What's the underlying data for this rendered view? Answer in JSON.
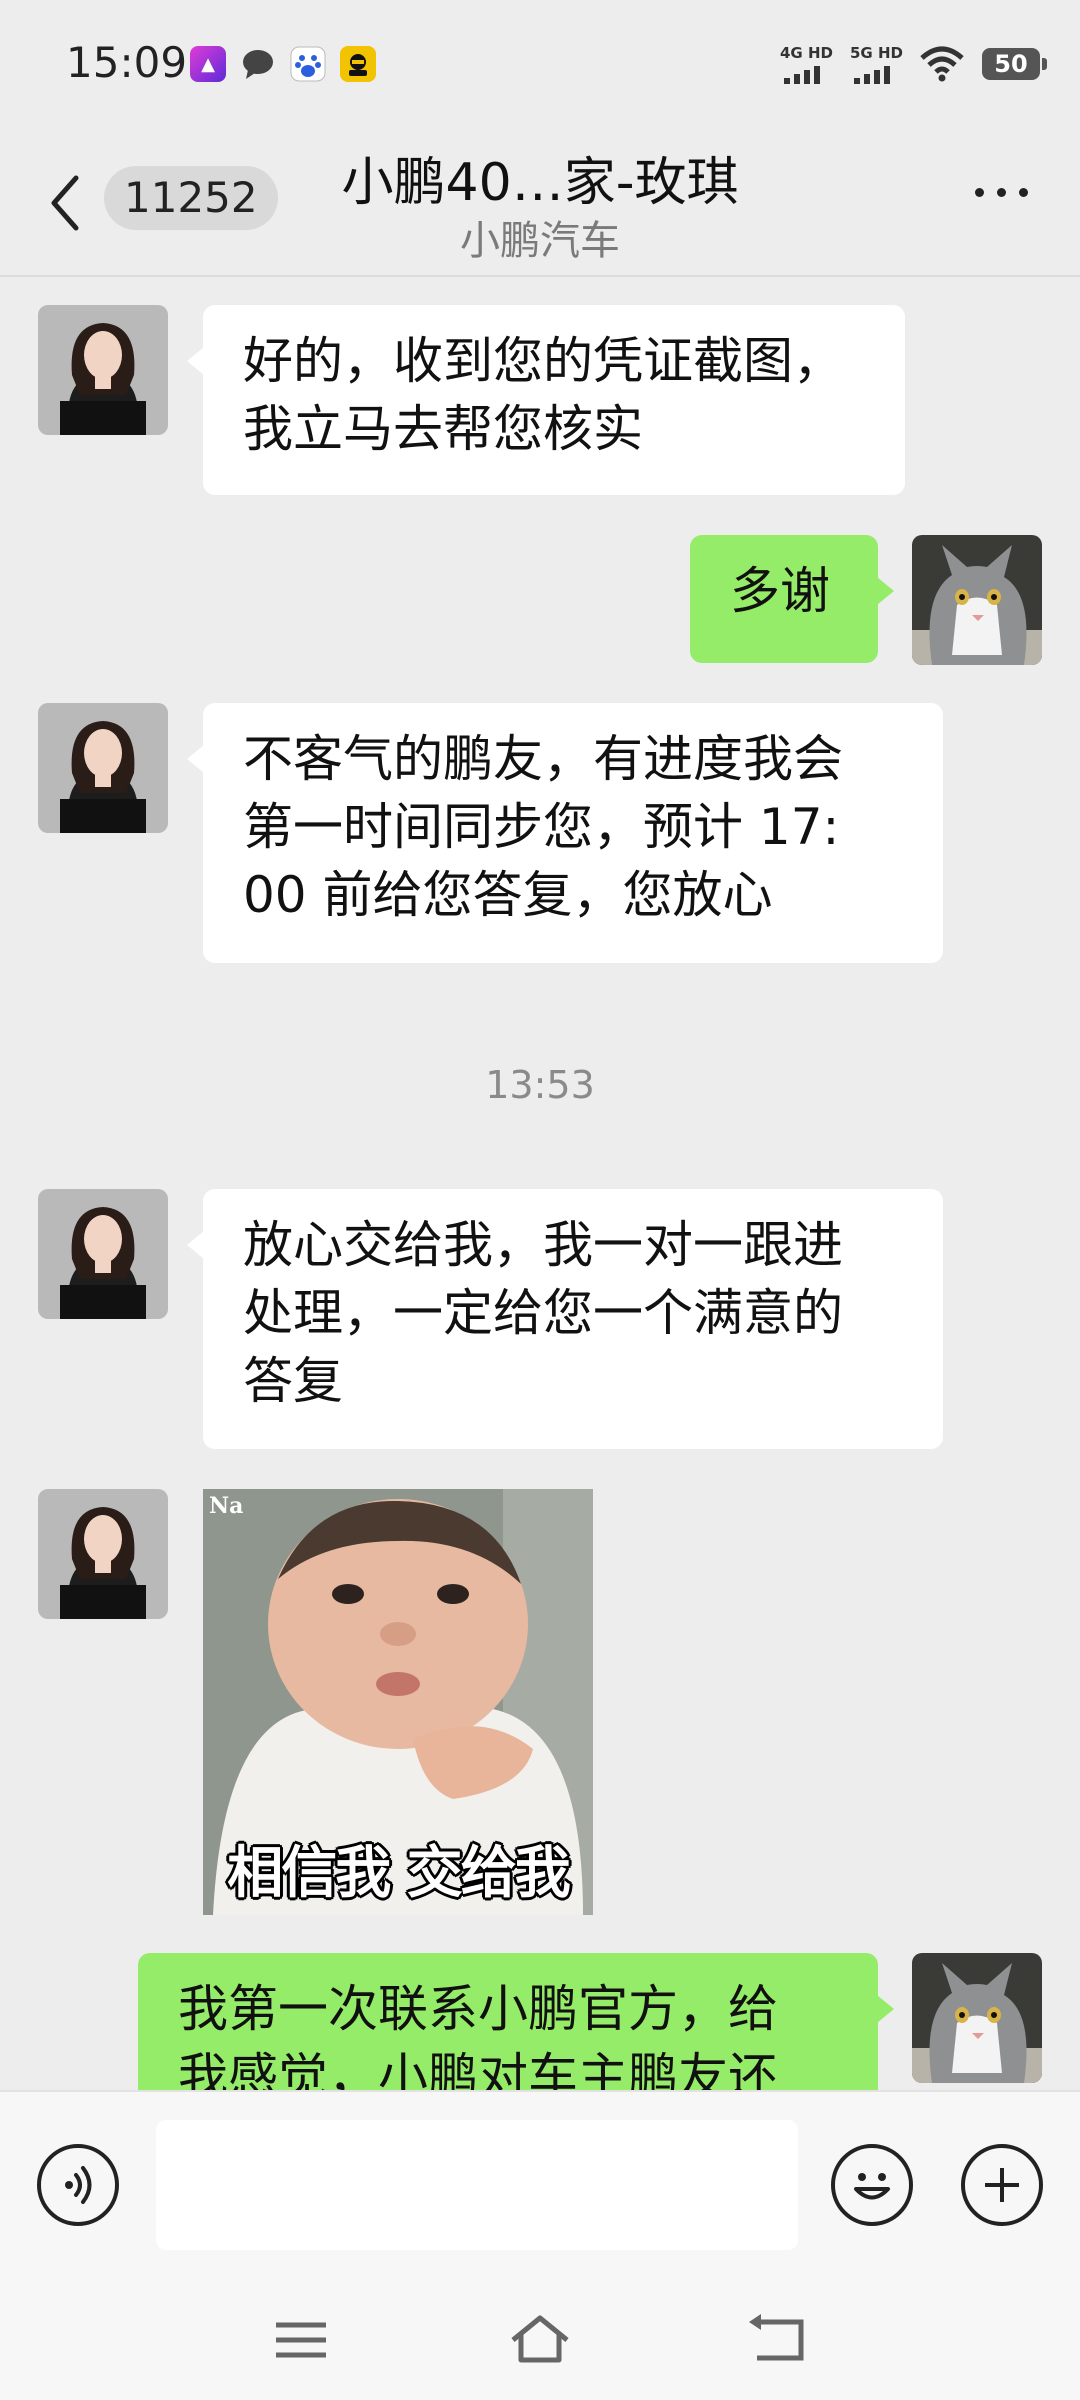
{
  "status_bar": {
    "time": "15:09",
    "network_1": "4G HD",
    "network_2": "5G HD",
    "battery": "50"
  },
  "header": {
    "unread_count": "11252",
    "title": "小鹏40…家-玫琪",
    "subtitle": "小鹏汽车"
  },
  "messages": [
    {
      "side": "left",
      "type": "text",
      "text": "好的，收到您的凭证截图，\n我立马去帮您核实"
    },
    {
      "side": "right",
      "type": "text",
      "text": "多谢"
    },
    {
      "side": "left",
      "type": "text",
      "text": "不客气的鹏友，有进度我会\n第一时间同步您，预计 17:\n00 前给您答复，您放心"
    },
    {
      "side": "center",
      "type": "time",
      "text": "13:53"
    },
    {
      "side": "left",
      "type": "text",
      "text": "放心交给我，我一对一跟进\n处理，一定给您一个满意的\n答复"
    },
    {
      "side": "left",
      "type": "sticker",
      "caption": "相信我 交给我",
      "watermark": "Na"
    },
    {
      "side": "right",
      "type": "text",
      "text": "我第一次联系小鹏官方，给\n我感觉，小鹏对车主鹏友还"
    }
  ],
  "input": {
    "voice_icon": "voice-icon",
    "emoji_icon": "emoji-icon",
    "plus_icon": "plus-icon"
  },
  "colors": {
    "background": "#ededed",
    "bubble_self": "#95ec69",
    "bubble_other": "#ffffff"
  }
}
